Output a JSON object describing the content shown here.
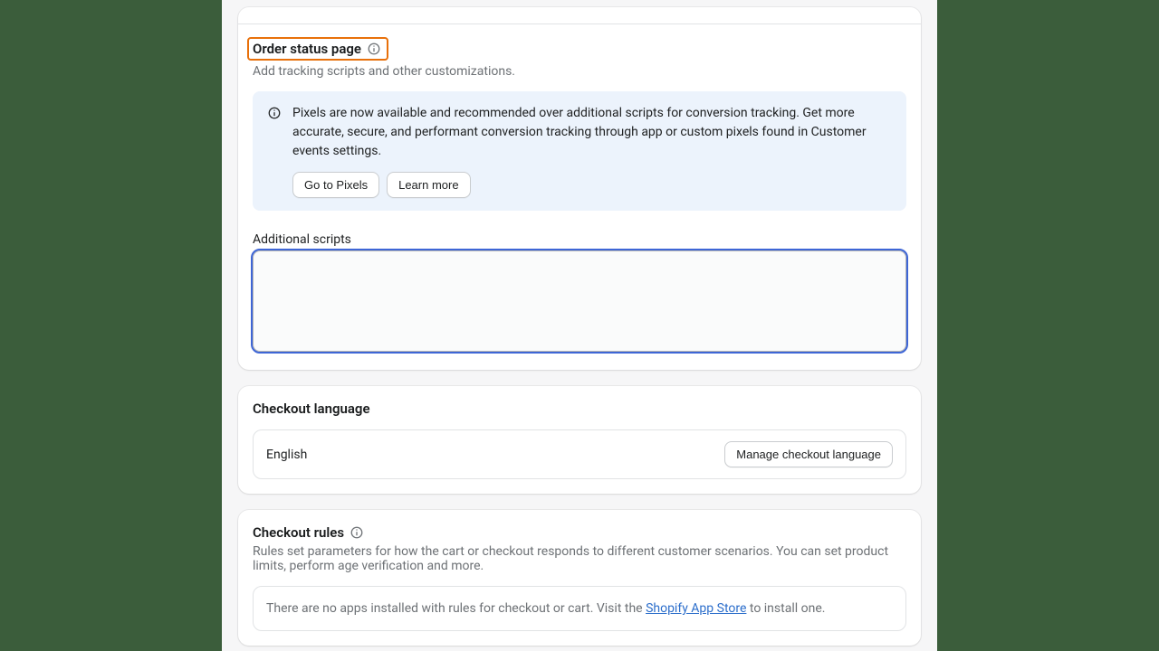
{
  "order_status": {
    "title": "Order status page",
    "subtitle": "Add tracking scripts and other customizations.",
    "banner_text": "Pixels are now available and recommended over additional scripts for conversion tracking. Get more accurate, secure, and performant conversion tracking through app or custom pixels found in Customer events settings.",
    "go_to_pixels_label": "Go to Pixels",
    "learn_more_label": "Learn more",
    "additional_scripts_label": "Additional scripts",
    "additional_scripts_value": ""
  },
  "checkout_language": {
    "title": "Checkout language",
    "current": "English",
    "manage_label": "Manage checkout language"
  },
  "checkout_rules": {
    "title": "Checkout rules",
    "subtitle": "Rules set parameters for how the cart or checkout responds to different customer scenarios. You can set product limits, perform age verification and more.",
    "callout_prefix": "There are no apps installed with rules for checkout or cart. Visit the ",
    "callout_link": "Shopify App Store",
    "callout_suffix": " to install one."
  }
}
